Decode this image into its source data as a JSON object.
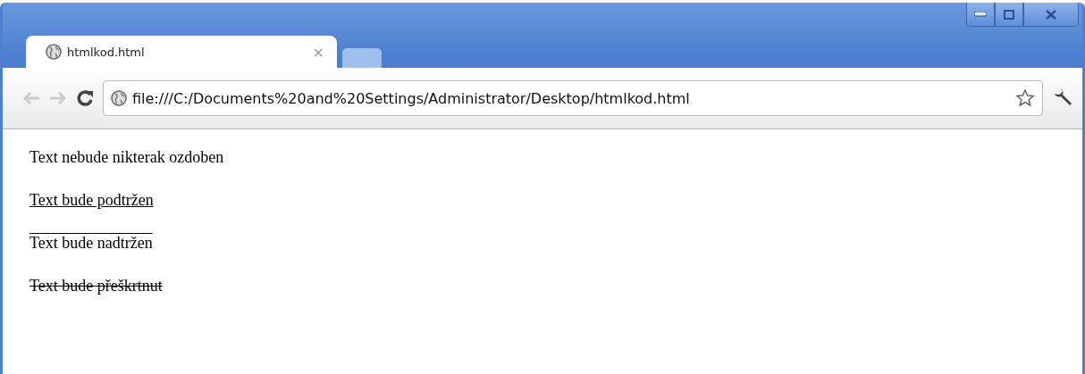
{
  "tabs": [
    {
      "title": "htmlkod.html",
      "close": "×",
      "selected": true
    }
  ],
  "address": {
    "value": "file:///C:/Documents%20and%20Settings/Administrator/Desktop/htmlkod.html"
  },
  "paragraphs": [
    {
      "text": "Text nebude nikterak ozdoben",
      "kind": "none"
    },
    {
      "text": "Text bude podtržen",
      "kind": "underline"
    },
    {
      "text": "Text bude nadtržen",
      "kind": "overline"
    },
    {
      "text": "Text bude přeškrtnut",
      "kind": "line-through"
    }
  ]
}
